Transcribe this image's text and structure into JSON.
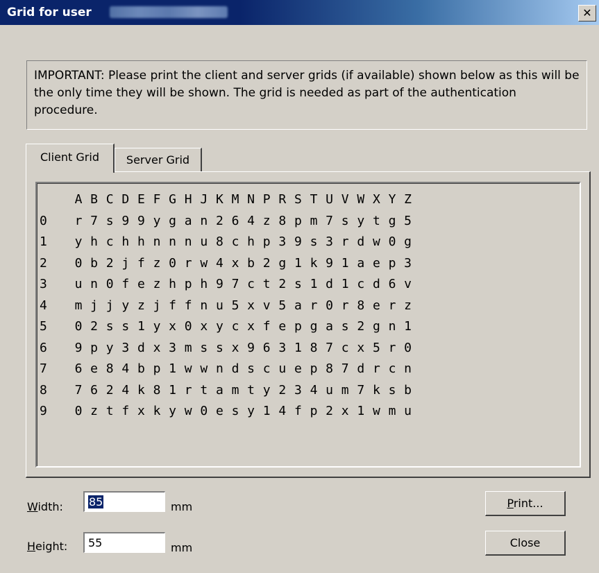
{
  "window": {
    "title": "Grid for user",
    "close_glyph": "✕"
  },
  "notice": {
    "text": "IMPORTANT: Please print the client and server grids (if available) shown below as this will be the only time they will be shown. The grid is needed as part of the authentication procedure."
  },
  "tabs": [
    {
      "label": "Client Grid",
      "active": true
    },
    {
      "label": "Server Grid",
      "active": false
    }
  ],
  "grid": {
    "columns": [
      "A",
      "B",
      "C",
      "D",
      "E",
      "F",
      "G",
      "H",
      "J",
      "K",
      "M",
      "N",
      "P",
      "R",
      "S",
      "T",
      "U",
      "V",
      "W",
      "X",
      "Y",
      "Z"
    ],
    "rows": [
      {
        "label": "0",
        "cells": [
          "r",
          "7",
          "s",
          "9",
          "9",
          "y",
          "g",
          "a",
          "n",
          "2",
          "6",
          "4",
          "z",
          "8",
          "p",
          "m",
          "7",
          "s",
          "y",
          "t",
          "g",
          "5"
        ]
      },
      {
        "label": "1",
        "cells": [
          "y",
          "h",
          "c",
          "h",
          "h",
          "n",
          "n",
          "n",
          "u",
          "8",
          "c",
          "h",
          "p",
          "3",
          "9",
          "s",
          "3",
          "r",
          "d",
          "w",
          "0",
          "g"
        ]
      },
      {
        "label": "2",
        "cells": [
          "0",
          "b",
          "2",
          "j",
          "f",
          "z",
          "0",
          "r",
          "w",
          "4",
          "x",
          "b",
          "2",
          "g",
          "1",
          "k",
          "9",
          "1",
          "a",
          "e",
          "p",
          "3"
        ]
      },
      {
        "label": "3",
        "cells": [
          "u",
          "n",
          "0",
          "f",
          "e",
          "z",
          "h",
          "p",
          "h",
          "9",
          "7",
          "c",
          "t",
          "2",
          "s",
          "1",
          "d",
          "1",
          "c",
          "d",
          "6",
          "v"
        ]
      },
      {
        "label": "4",
        "cells": [
          "m",
          "j",
          "j",
          "y",
          "z",
          "j",
          "f",
          "f",
          "n",
          "u",
          "5",
          "x",
          "v",
          "5",
          "a",
          "r",
          "0",
          "r",
          "8",
          "e",
          "r",
          "z"
        ]
      },
      {
        "label": "5",
        "cells": [
          "0",
          "2",
          "s",
          "s",
          "1",
          "y",
          "x",
          "0",
          "x",
          "y",
          "c",
          "x",
          "f",
          "e",
          "p",
          "g",
          "a",
          "s",
          "2",
          "g",
          "n",
          "1"
        ]
      },
      {
        "label": "6",
        "cells": [
          "9",
          "p",
          "y",
          "3",
          "d",
          "x",
          "3",
          "m",
          "s",
          "s",
          "x",
          "9",
          "6",
          "3",
          "1",
          "8",
          "7",
          "c",
          "x",
          "5",
          "r",
          "0"
        ]
      },
      {
        "label": "7",
        "cells": [
          "6",
          "e",
          "8",
          "4",
          "b",
          "p",
          "1",
          "w",
          "w",
          "n",
          "d",
          "s",
          "c",
          "u",
          "e",
          "p",
          "8",
          "7",
          "d",
          "r",
          "c",
          "n"
        ]
      },
      {
        "label": "8",
        "cells": [
          "7",
          "6",
          "2",
          "4",
          "k",
          "8",
          "1",
          "r",
          "t",
          "a",
          "m",
          "t",
          "y",
          "2",
          "3",
          "4",
          "u",
          "m",
          "7",
          "k",
          "s",
          "b"
        ]
      },
      {
        "label": "9",
        "cells": [
          "0",
          "z",
          "t",
          "f",
          "x",
          "k",
          "y",
          "w",
          "0",
          "e",
          "s",
          "y",
          "1",
          "4",
          "f",
          "p",
          "2",
          "x",
          "1",
          "w",
          "m",
          "u"
        ]
      }
    ]
  },
  "width_field": {
    "label_u": "W",
    "label_rest": "idth:",
    "value": "85",
    "unit": "mm"
  },
  "height_field": {
    "label_u": "H",
    "label_rest": "eight:",
    "value": "55",
    "unit": "mm"
  },
  "buttons": {
    "print_u": "P",
    "print_rest": "rint...",
    "close": "Close"
  }
}
